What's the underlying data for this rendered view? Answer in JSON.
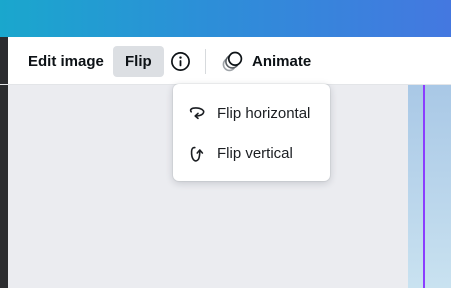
{
  "toolbar": {
    "edit_image_label": "Edit image",
    "flip_label": "Flip",
    "info_icon": "info-circle-icon",
    "animate_label": "Animate",
    "animate_icon": "animate-circles-icon"
  },
  "flip_menu": {
    "items": [
      {
        "label": "Flip horizontal",
        "icon": "flip-horizontal-icon"
      },
      {
        "label": "Flip vertical",
        "icon": "flip-vertical-icon"
      }
    ]
  },
  "colors": {
    "header_gradient_start": "#1aa7cd",
    "header_gradient_end": "#4478e0",
    "selection_accent": "#8b3dff",
    "flip_active_bg": "#dcdfe3",
    "canvas_bg": "#ebecf0"
  }
}
